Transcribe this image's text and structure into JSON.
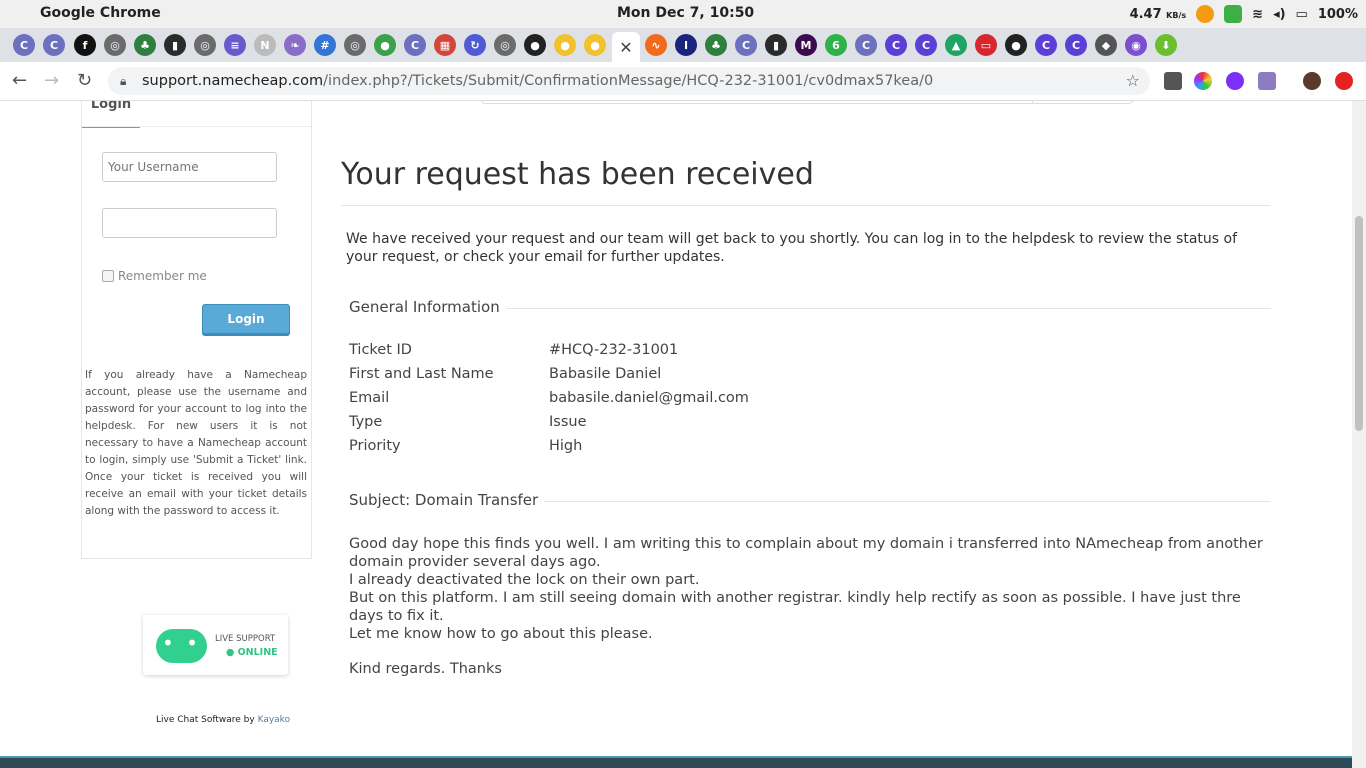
{
  "menubar": {
    "app_name": "Google Chrome",
    "clock": "Mon Dec  7, 10:50",
    "net_speed": "4.47",
    "net_unit": "KB/s",
    "battery": "100%"
  },
  "tabs": {
    "active_close": "✕",
    "new_tab": "+",
    "items": [
      {
        "icon": "c-icon",
        "color": "#6d6fbf",
        "glyph": "C"
      },
      {
        "icon": "c-icon",
        "color": "#6d6fbf",
        "glyph": "C"
      },
      {
        "icon": "f-icon",
        "color": "#111111",
        "glyph": "f"
      },
      {
        "icon": "globe-icon",
        "color": "#6b6b6b",
        "glyph": "◎"
      },
      {
        "icon": "leaf-icon",
        "color": "#2f7f3f",
        "glyph": "♣"
      },
      {
        "icon": "square-icon",
        "color": "#2b2b2b",
        "glyph": "▮"
      },
      {
        "icon": "globe-icon",
        "color": "#6b6b6b",
        "glyph": "◎"
      },
      {
        "icon": "docs-icon",
        "color": "#6a5acd",
        "glyph": "≡"
      },
      {
        "icon": "nikki-icon",
        "color": "#bbbbbb",
        "glyph": "N"
      },
      {
        "icon": "feather-icon",
        "color": "#8a6cc9",
        "glyph": "❧"
      },
      {
        "icon": "hash-icon",
        "color": "#3474d4",
        "glyph": "#"
      },
      {
        "icon": "globe-icon",
        "color": "#6b6b6b",
        "glyph": "◎"
      },
      {
        "icon": "leaf-icon",
        "color": "#3ca14a",
        "glyph": "●"
      },
      {
        "icon": "c-icon",
        "color": "#6d6fbf",
        "glyph": "C"
      },
      {
        "icon": "grid-icon",
        "color": "#d3463a",
        "glyph": "▦"
      },
      {
        "icon": "refresh-icon",
        "color": "#4f5bd5",
        "glyph": "↻"
      },
      {
        "icon": "globe-icon",
        "color": "#6b6b6b",
        "glyph": "◎"
      },
      {
        "icon": "github-icon",
        "color": "#222222",
        "glyph": "●"
      },
      {
        "icon": "bulb-icon",
        "color": "#f2c12e",
        "glyph": "●"
      },
      {
        "icon": "bulb-icon",
        "color": "#f2c12e",
        "glyph": "●"
      },
      {
        "icon": "wave-icon",
        "color": "#f26b1d",
        "glyph": "∿"
      },
      {
        "icon": "i-icon",
        "color": "#1a237e",
        "glyph": "I"
      },
      {
        "icon": "leaf-icon",
        "color": "#2f7f3f",
        "glyph": "♣"
      },
      {
        "icon": "c-icon",
        "color": "#6d6fbf",
        "glyph": "C"
      },
      {
        "icon": "square-icon",
        "color": "#2b2b2b",
        "glyph": "▮"
      },
      {
        "icon": "m-icon",
        "color": "#3b0a4f",
        "glyph": "M"
      },
      {
        "icon": "six-icon",
        "color": "#2db34a",
        "glyph": "6"
      },
      {
        "icon": "c-icon",
        "color": "#6d6fbf",
        "glyph": "C"
      },
      {
        "icon": "c-icon",
        "color": "#5c3fd6",
        "glyph": "C"
      },
      {
        "icon": "c-icon",
        "color": "#5c3fd6",
        "glyph": "C"
      },
      {
        "icon": "drive-icon",
        "color": "#1fa463",
        "glyph": "▲"
      },
      {
        "icon": "oracle-icon",
        "color": "#d8262f",
        "glyph": "▭"
      },
      {
        "icon": "github-icon",
        "color": "#222222",
        "glyph": "●"
      },
      {
        "icon": "c-icon",
        "color": "#5c3fd6",
        "glyph": "C"
      },
      {
        "icon": "c-icon",
        "color": "#5c3fd6",
        "glyph": "C"
      },
      {
        "icon": "cap-icon",
        "color": "#555555",
        "glyph": "◆"
      },
      {
        "icon": "planet-icon",
        "color": "#7b4fd0",
        "glyph": "◉"
      },
      {
        "icon": "download-icon",
        "color": "#6abf2e",
        "glyph": "⬇"
      }
    ]
  },
  "toolbar": {
    "url_domain": "support.namecheap.com",
    "url_path": "/index.php?/Tickets/Submit/ConfirmationMessage/HCQ-232-31001/cv0dmax57kea/0"
  },
  "sidebar": {
    "login_tab": "Login",
    "username_placeholder": "Your Username",
    "remember_label": "Remember me",
    "login_button": "Login",
    "help_text": "If you already have a Namecheap account, please use the username and password for your account to log into the helpdesk. For new users it is not necessary to have a Namecheap account to login, simply use 'Submit a Ticket' link. Once your ticket is received you will receive an email with your ticket details along with the password to access it.",
    "live_support": "LIVE SUPPORT",
    "online": "● ONLINE",
    "chat_dots": "• • •",
    "powered_prefix": "Live Chat Software by ",
    "powered_link": "Kayako"
  },
  "main": {
    "title": "Your request has been received",
    "intro": "We have received your request and our team will get back to you shortly. You can log in to the helpdesk to review the status of your request, or check your email for further updates.",
    "general_info_title": "General Information",
    "fields": [
      {
        "label": "Ticket ID",
        "value": "#HCQ-232-31001"
      },
      {
        "label": "First and Last Name",
        "value": "Babasile Daniel"
      },
      {
        "label": "Email",
        "value": "babasile.daniel@gmail.com"
      },
      {
        "label": "Type",
        "value": "Issue"
      },
      {
        "label": "Priority",
        "value": "High"
      }
    ],
    "subject": "Subject: Domain Transfer",
    "message": [
      "Good day hope this finds you well. I am writing this to complain about my domain i transferred into NAmecheap from another domain provider several days ago.",
      "I already deactivated the lock on their own part.",
      "But on this platform. I am still seeing domain with another registrar. kindly help rectify as soon as possible. I have just thre days to fix it.",
      "Let me know how to go about this please."
    ],
    "regards": "Kind regards. Thanks"
  }
}
